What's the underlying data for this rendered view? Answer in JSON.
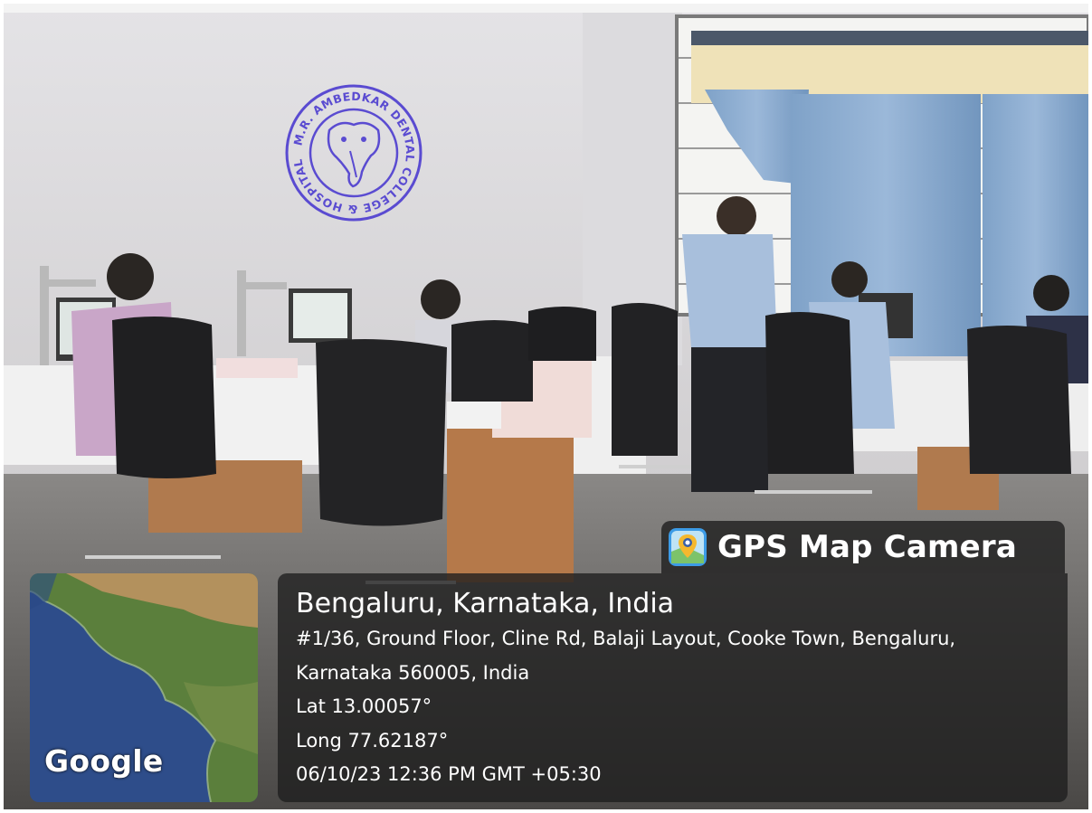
{
  "watermark": {
    "app_name": "GPS Map Camera",
    "app_icon": "map-pin-app-icon",
    "map_provider_logo": "Google"
  },
  "stamp": {
    "text": "M.R. AMBEDKAR DENTAL COLLEGE & HOSPITAL",
    "color": "#5a4bd1"
  },
  "location": {
    "city_line": "Bengaluru, Karnataka, India",
    "address_line_1": "#1/36, Ground Floor, Cline Rd, Balaji Layout, Cooke Town, Bengaluru,",
    "address_line_2": "Karnataka 560005, India",
    "latitude": "Lat 13.00057°",
    "longitude": "Long 77.62187°",
    "timestamp": "06/10/23 12:36 PM GMT +05:30"
  }
}
